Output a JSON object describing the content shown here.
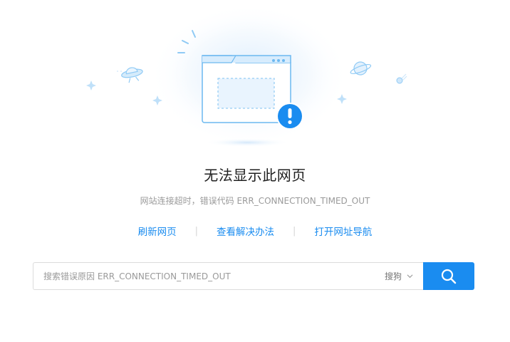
{
  "error": {
    "title": "无法显示此网页",
    "subtitle": "网站连接超时，错误代码 ERR_CONNECTION_TIMED_OUT"
  },
  "links": [
    {
      "label": "刷新网页"
    },
    {
      "label": "查看解决办法"
    },
    {
      "label": "打开网址导航"
    }
  ],
  "links_separator": "|",
  "search": {
    "placeholder": "搜索错误原因 ERR_CONNECTION_TIMED_OUT",
    "engine": "搜狗",
    "button_icon": "search-icon"
  },
  "colors": {
    "accent": "#1a8cf0",
    "illustration_blue": "#6cb8f0",
    "alert": "#1a8cf0"
  }
}
